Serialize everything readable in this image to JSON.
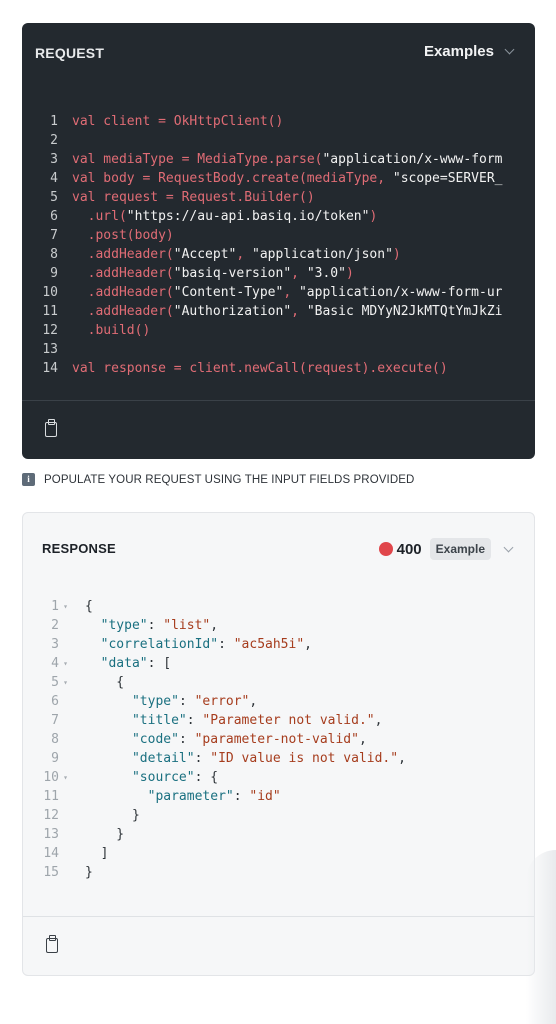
{
  "request": {
    "title": "REQUEST",
    "examples_label": "Examples",
    "lines": [
      {
        "n": "1",
        "parts": [
          [
            "plain",
            "val client = "
          ],
          [
            "fn",
            "OkHttpClient"
          ],
          [
            "plain",
            "()"
          ]
        ]
      },
      {
        "n": "2",
        "parts": []
      },
      {
        "n": "3",
        "parts": [
          [
            "plain",
            "val mediaType = "
          ],
          [
            "fn",
            "MediaType"
          ],
          [
            "plain",
            ".parse("
          ],
          [
            "str",
            "\"application/x-www-form"
          ]
        ]
      },
      {
        "n": "4",
        "parts": [
          [
            "plain",
            "val body = "
          ],
          [
            "fn",
            "RequestBody"
          ],
          [
            "plain",
            ".create(mediaType, "
          ],
          [
            "str",
            "\"scope=SERVER_"
          ]
        ]
      },
      {
        "n": "5",
        "parts": [
          [
            "plain",
            "val request = "
          ],
          [
            "fn",
            "Request"
          ],
          [
            "plain",
            ".Builder()"
          ]
        ]
      },
      {
        "n": "6",
        "parts": [
          [
            "plain",
            "  .url("
          ],
          [
            "str",
            "\"https://au-api.basiq.io/token\""
          ],
          [
            "plain",
            ")"
          ]
        ]
      },
      {
        "n": "7",
        "parts": [
          [
            "plain",
            "  .post(body)"
          ]
        ]
      },
      {
        "n": "8",
        "parts": [
          [
            "plain",
            "  .addHeader("
          ],
          [
            "str",
            "\"Accept\""
          ],
          [
            "plain",
            ", "
          ],
          [
            "str",
            "\"application/json\""
          ],
          [
            "plain",
            ")"
          ]
        ]
      },
      {
        "n": "9",
        "parts": [
          [
            "plain",
            "  .addHeader("
          ],
          [
            "str",
            "\"basiq-version\""
          ],
          [
            "plain",
            ", "
          ],
          [
            "str",
            "\"3.0\""
          ],
          [
            "plain",
            ")"
          ]
        ]
      },
      {
        "n": "10",
        "parts": [
          [
            "plain",
            "  .addHeader("
          ],
          [
            "str",
            "\"Content-Type\""
          ],
          [
            "plain",
            ", "
          ],
          [
            "str",
            "\"application/x-www-form-ur"
          ]
        ]
      },
      {
        "n": "11",
        "parts": [
          [
            "plain",
            "  .addHeader("
          ],
          [
            "str",
            "\"Authorization\""
          ],
          [
            "plain",
            ", "
          ],
          [
            "str",
            "\"Basic MDYyN2JkMTQtYmJkZi"
          ]
        ]
      },
      {
        "n": "12",
        "parts": [
          [
            "plain",
            "  .build()"
          ]
        ]
      },
      {
        "n": "13",
        "parts": []
      },
      {
        "n": "14",
        "parts": [
          [
            "plain",
            "val response = client.newCall(request).execute()"
          ]
        ]
      }
    ]
  },
  "info": {
    "icon": "info-icon",
    "text": "POPULATE YOUR REQUEST USING THE INPUT FIELDS PROVIDED"
  },
  "response": {
    "title": "RESPONSE",
    "status_code": "400",
    "status_color": "#e0464b",
    "example_label": "Example",
    "lines": [
      {
        "n": "1",
        "fold": true,
        "parts": [
          [
            "punct",
            "{"
          ]
        ]
      },
      {
        "n": "2",
        "fold": false,
        "parts": [
          [
            "punct",
            "  "
          ],
          [
            "key",
            "\"type\""
          ],
          [
            "punct",
            ": "
          ],
          [
            "str",
            "\"list\""
          ],
          [
            "punct",
            ","
          ]
        ]
      },
      {
        "n": "3",
        "fold": false,
        "parts": [
          [
            "punct",
            "  "
          ],
          [
            "key",
            "\"correlationId\""
          ],
          [
            "punct",
            ": "
          ],
          [
            "str",
            "\"ac5ah5i\""
          ],
          [
            "punct",
            ","
          ]
        ]
      },
      {
        "n": "4",
        "fold": true,
        "parts": [
          [
            "punct",
            "  "
          ],
          [
            "key",
            "\"data\""
          ],
          [
            "punct",
            ": ["
          ]
        ]
      },
      {
        "n": "5",
        "fold": true,
        "parts": [
          [
            "punct",
            "    {"
          ]
        ]
      },
      {
        "n": "6",
        "fold": false,
        "parts": [
          [
            "punct",
            "      "
          ],
          [
            "key",
            "\"type\""
          ],
          [
            "punct",
            ": "
          ],
          [
            "str",
            "\"error\""
          ],
          [
            "punct",
            ","
          ]
        ]
      },
      {
        "n": "7",
        "fold": false,
        "parts": [
          [
            "punct",
            "      "
          ],
          [
            "key",
            "\"title\""
          ],
          [
            "punct",
            ": "
          ],
          [
            "str",
            "\"Parameter not valid.\""
          ],
          [
            "punct",
            ","
          ]
        ]
      },
      {
        "n": "8",
        "fold": false,
        "parts": [
          [
            "punct",
            "      "
          ],
          [
            "key",
            "\"code\""
          ],
          [
            "punct",
            ": "
          ],
          [
            "str",
            "\"parameter-not-valid\""
          ],
          [
            "punct",
            ","
          ]
        ]
      },
      {
        "n": "9",
        "fold": false,
        "parts": [
          [
            "punct",
            "      "
          ],
          [
            "key",
            "\"detail\""
          ],
          [
            "punct",
            ": "
          ],
          [
            "str",
            "\"ID value is not valid.\""
          ],
          [
            "punct",
            ","
          ]
        ]
      },
      {
        "n": "10",
        "fold": true,
        "parts": [
          [
            "punct",
            "      "
          ],
          [
            "key",
            "\"source\""
          ],
          [
            "punct",
            ": {"
          ]
        ]
      },
      {
        "n": "11",
        "fold": false,
        "parts": [
          [
            "punct",
            "        "
          ],
          [
            "key",
            "\"parameter\""
          ],
          [
            "punct",
            ": "
          ],
          [
            "str",
            "\"id\""
          ]
        ]
      },
      {
        "n": "12",
        "fold": false,
        "parts": [
          [
            "punct",
            "      }"
          ]
        ]
      },
      {
        "n": "13",
        "fold": false,
        "parts": [
          [
            "punct",
            "    }"
          ]
        ]
      },
      {
        "n": "14",
        "fold": false,
        "parts": [
          [
            "punct",
            "  ]"
          ]
        ]
      },
      {
        "n": "15",
        "fold": false,
        "parts": [
          [
            "punct",
            "}"
          ]
        ]
      }
    ]
  },
  "copy_icon": "clipboard-icon"
}
